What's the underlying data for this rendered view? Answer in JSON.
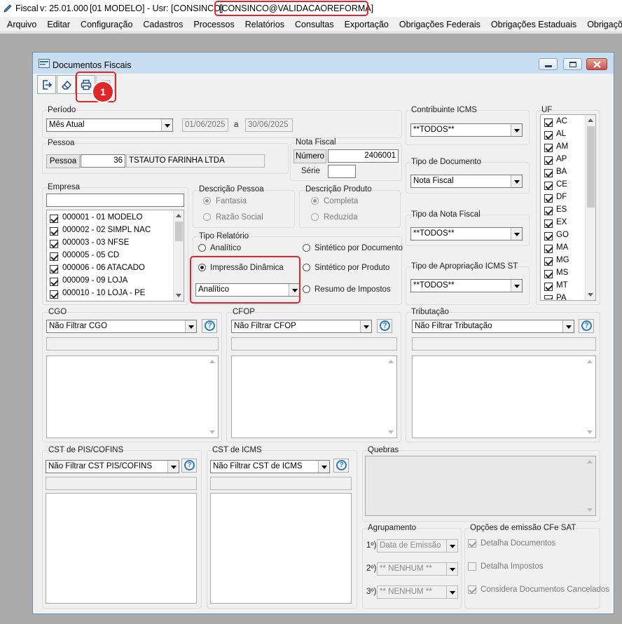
{
  "app": {
    "name": "Fiscal",
    "version": "v: 25.01.000",
    "company": "[01 MODELO]",
    "user": "- Usr: [CONSINCO]",
    "connection": "[CONSINCO@VALIDACAOREFORMA]"
  },
  "menu": [
    "Arquivo",
    "Editar",
    "Configuração",
    "Cadastros",
    "Processos",
    "Relatórios",
    "Consultas",
    "Exportação",
    "Obrigações Federais",
    "Obrigações Estaduais",
    "Obrigações Mun"
  ],
  "window": {
    "title": "Documentos Fiscais"
  },
  "toolbar": {
    "exit_icon": "exit-icon",
    "clear_icon": "eraser-icon",
    "print_icon": "printer-icon",
    "disabled_icon": "export-icon",
    "badge": "1"
  },
  "periodo": {
    "label": "Período",
    "value": "Mês Atual",
    "start": "01/06/2025",
    "sep": "a",
    "end": "30/06/2025"
  },
  "pessoa": {
    "label": "Pessoa",
    "button": "Pessoa",
    "code": "36",
    "name": "TSTAUTO FARINHA LTDA"
  },
  "nota": {
    "label": "Nota Fiscal",
    "numero_label": "Número",
    "numero": "2406001",
    "serie_label": "Série",
    "serie": ""
  },
  "empresa": {
    "label": "Empresa",
    "search": "",
    "items": [
      "000001 - 01 MODELO",
      "000002 - 02 SIMPL NAC",
      "000003 - 03 NFSE",
      "000005 - 05 CD",
      "000006 - 06 ATACADO",
      "000009 - 09 LOJA",
      "000010 - 10 LOJA - PE"
    ]
  },
  "desc_pessoa": {
    "label": "Descrição Pessoa",
    "opt1": "Fantasia",
    "opt2": "Razão Social"
  },
  "desc_produto": {
    "label": "Descrição Produto",
    "opt1": "Completa",
    "opt2": "Reduzida"
  },
  "tipo_relatorio": {
    "label": "Tipo Relatório",
    "analitico": "Analítico",
    "impressao": "Impressão Dinâmica",
    "sint_doc": "Sintético por Documento",
    "sint_prod": "Sintético por Produto",
    "resumo": "Resumo de Impostos",
    "select": "Analítico"
  },
  "contribuinte": {
    "label": "Contribuinte ICMS",
    "value": "**TODOS**"
  },
  "tipo_doc": {
    "label": "Tipo de Documento",
    "value": "Nota Fiscal"
  },
  "tipo_nota": {
    "label": "Tipo da Nota Fiscal",
    "value": "**TODOS**"
  },
  "tipo_aprop": {
    "label": "Tipo de Apropriação ICMS ST",
    "value": "**TODOS**"
  },
  "uf": {
    "label": "UF",
    "items": [
      "AC",
      "AL",
      "AM",
      "AP",
      "BA",
      "CE",
      "DF",
      "ES",
      "EX",
      "GO",
      "MA",
      "MG",
      "MS",
      "MT",
      "PA"
    ]
  },
  "cgo": {
    "label": "CGO",
    "value": "Não Filtrar CGO"
  },
  "cfop": {
    "label": "CFOP",
    "value": "Não Filtrar CFOP"
  },
  "tributacao": {
    "label": "Tributação",
    "value": "Não Filtrar Tributação"
  },
  "cst_pis": {
    "label": "CST de PIS/COFINS",
    "value": "Não Filtrar CST PIS/COFINS"
  },
  "cst_icms": {
    "label": "CST de ICMS",
    "value": "Não Filtrar CST de ICMS"
  },
  "quebras": {
    "label": "Quebras"
  },
  "agrupamento": {
    "label": "Agrupamento",
    "r1": "1º)",
    "v1": "Data de Emissão",
    "r2": "2º)",
    "v2": "** NENHUM **",
    "r3": "3º)",
    "v3": "** NENHUM **"
  },
  "cfe": {
    "label": "Opções de emissão CFe SAT",
    "o1": "Detalha Documentos",
    "o2": "Detalha Impostos",
    "o3": "Considera Documentos Cancelados"
  },
  "help_label": "?"
}
